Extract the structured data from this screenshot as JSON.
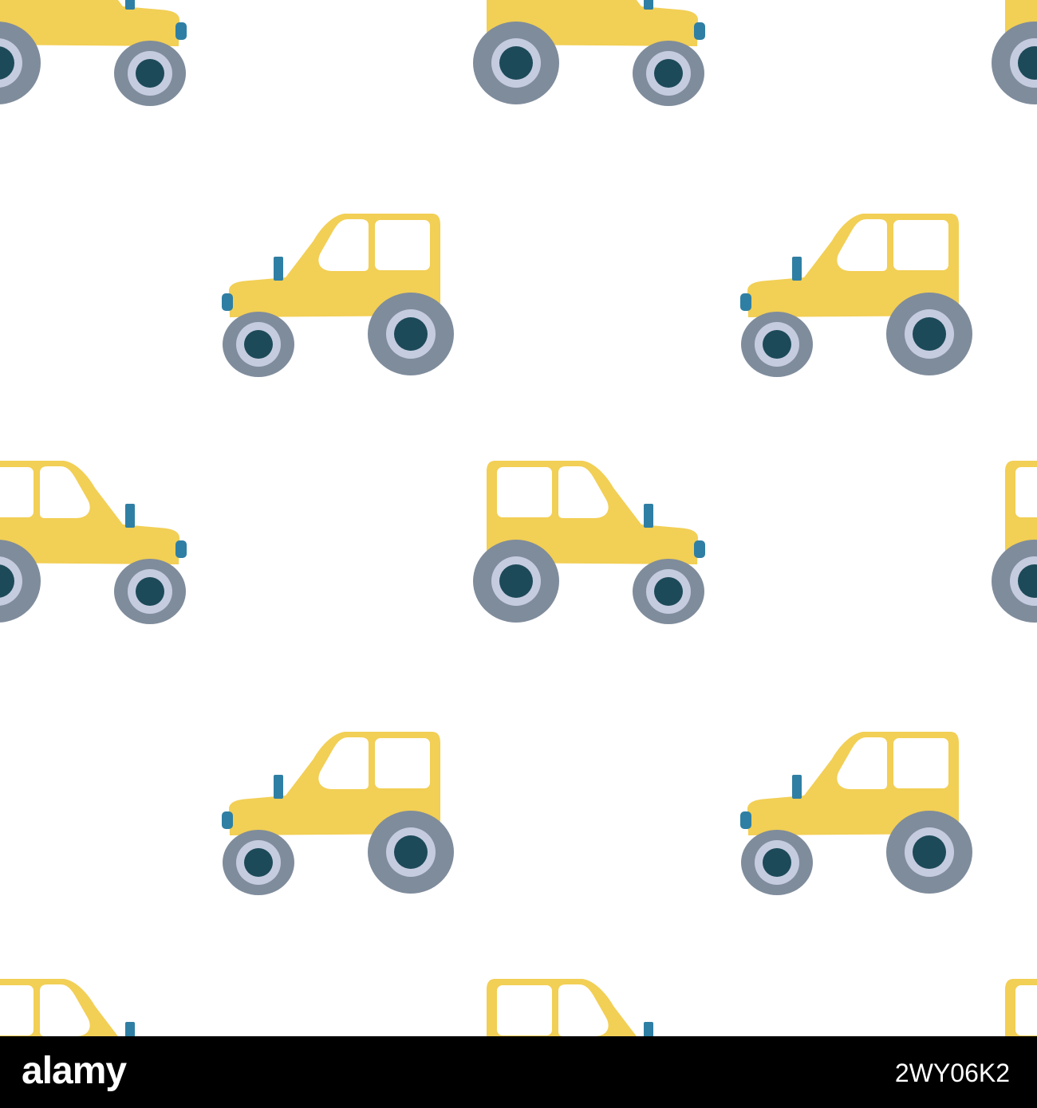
{
  "pattern": {
    "description_icon": "tractor-icon",
    "colors": {
      "background": "#ffffff",
      "body": "#f2cf55",
      "window": "#ffffff",
      "tire": "#7f8c9c",
      "rim": "#c5cce0",
      "hub": "#1d4a59",
      "exhaust": "#2f7fa4",
      "light": "#2f7fa4"
    }
  },
  "footer": {
    "logo_text": "alamy",
    "image_id": "2WY06K2",
    "background": "#000000"
  }
}
